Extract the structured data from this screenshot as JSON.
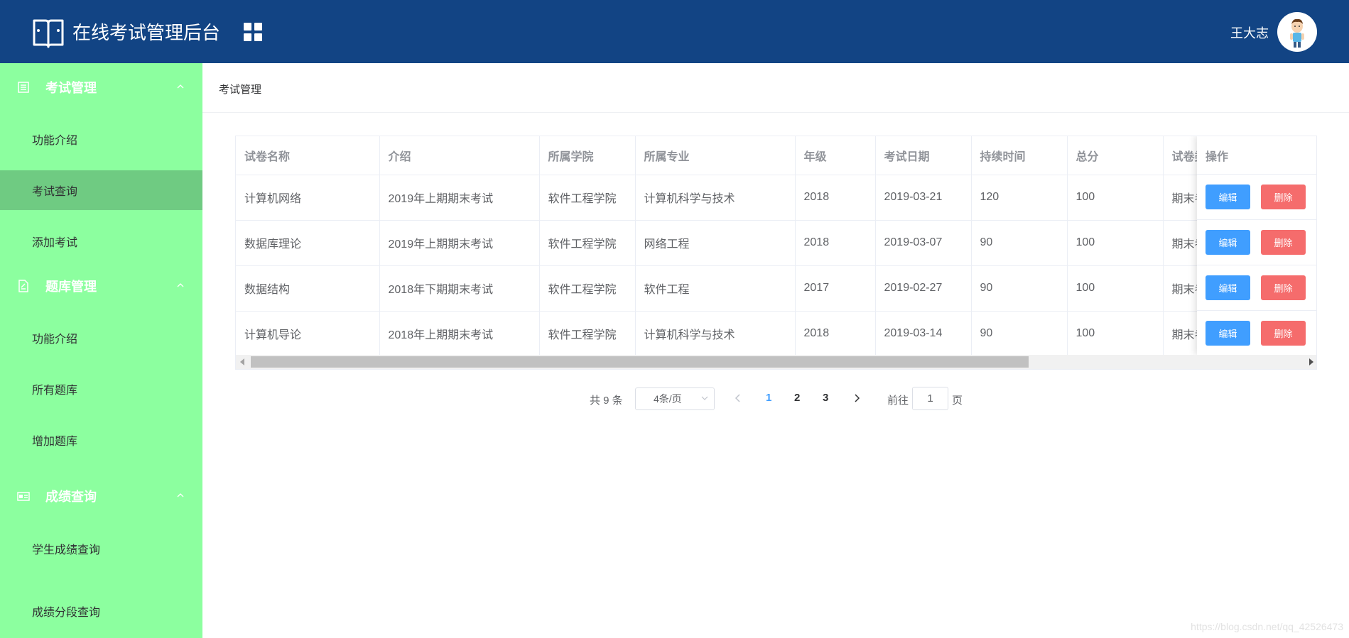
{
  "header": {
    "title": "在线考试管理后台",
    "user_name": "王大志"
  },
  "sidebar": {
    "groups": [
      {
        "title": "考试管理",
        "items": [
          "功能介绍",
          "考试查询",
          "添加考试"
        ]
      },
      {
        "title": "题库管理",
        "items": [
          "功能介绍",
          "所有题库",
          "增加题库"
        ]
      },
      {
        "title": "成绩查询",
        "items": [
          "学生成绩查询",
          "成绩分段查询"
        ]
      }
    ],
    "active_item": "考试查询",
    "background": "#8cff9f",
    "active_background": "#6fcb82"
  },
  "breadcrumb": "考试管理",
  "table": {
    "headers": [
      "试卷名称",
      "介绍",
      "所属学院",
      "所属专业",
      "年级",
      "考试日期",
      "持续时间",
      "总分",
      "试卷类型"
    ],
    "header_visible": [
      "试卷名称",
      "介绍",
      "所属学院",
      "所属专业",
      "年级",
      "考试日期",
      "持续时间",
      "总分",
      "试卷类"
    ],
    "action_header": "操作",
    "rows": [
      [
        "计算机网络",
        "2019年上期期末考试",
        "软件工程学院",
        "计算机科学与技术",
        "2018",
        "2019-03-21",
        "120",
        "100",
        "期末考"
      ],
      [
        "数据库理论",
        "2019年上期期末考试",
        "软件工程学院",
        "网络工程",
        "2018",
        "2019-03-07",
        "90",
        "100",
        "期末考"
      ],
      [
        "数据结构",
        "2018年下期期末考试",
        "软件工程学院",
        "软件工程",
        "2017",
        "2019-02-27",
        "90",
        "100",
        "期末考"
      ],
      [
        "计算机导论",
        "2018年上期期末考试",
        "软件工程学院",
        "计算机科学与技术",
        "2018",
        "2019-03-14",
        "90",
        "100",
        "期末考"
      ]
    ],
    "edit_label": "编辑",
    "delete_label": "删除"
  },
  "pagination": {
    "total_text": "共 9 条",
    "page_size": "4条/页",
    "pages": [
      "1",
      "2",
      "3"
    ],
    "current_page": "1",
    "goto_label": "前往",
    "goto_value": "1",
    "page_suffix": "页"
  },
  "watermark": "https://blog.csdn.net/qq_42526473",
  "colors": {
    "header": "#124484",
    "primary": "#409eff",
    "danger": "#f56c6c"
  }
}
